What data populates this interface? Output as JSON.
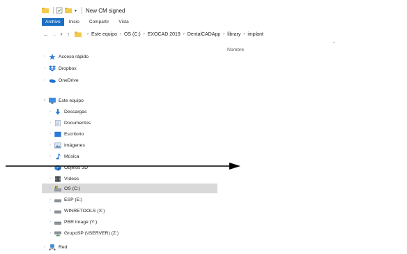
{
  "window": {
    "title": "New CM signed"
  },
  "ribbon": {
    "tabs": [
      "Archivo",
      "Inicio",
      "Compartir",
      "Vista"
    ]
  },
  "address": {
    "crumbs": [
      "Este equipo",
      "OS (C:)",
      "EXOCAD 2019",
      "DentalCADApp",
      "library",
      "implant"
    ]
  },
  "content": {
    "column_header": "Nombre"
  },
  "nav": {
    "items": [
      {
        "label": "Acceso rápido",
        "icon": "star-icon"
      },
      {
        "label": "Dropbox",
        "icon": "dropbox-icon"
      },
      {
        "label": "OneDrive",
        "icon": "cloud-icon"
      },
      {
        "label": "Este equipo",
        "icon": "computer-icon"
      },
      {
        "label": "Descargas",
        "icon": "download-icon"
      },
      {
        "label": "Documentos",
        "icon": "document-icon"
      },
      {
        "label": "Escritorio",
        "icon": "desktop-icon"
      },
      {
        "label": "Imágenes",
        "icon": "pictures-icon"
      },
      {
        "label": "Música",
        "icon": "music-icon"
      },
      {
        "label": "Objetos 3D",
        "icon": "objects-3d-icon"
      },
      {
        "label": "Vídeos",
        "icon": "videos-icon"
      },
      {
        "label": "OS (C:)",
        "icon": "drive-icon"
      },
      {
        "label": "ESP (E:)",
        "icon": "drive-icon"
      },
      {
        "label": "WINRETOOLS (X:)",
        "icon": "drive-icon"
      },
      {
        "label": "PBR Image (Y:)",
        "icon": "drive-icon"
      },
      {
        "label": "GrupoSP (\\\\SERVER) (Z:)",
        "icon": "network-drive-icon"
      },
      {
        "label": "Red",
        "icon": "network-icon"
      }
    ]
  },
  "colors": {
    "accent": "#1a6fc3",
    "selected_row": "#d9d9d9",
    "folder": "#f3c94b"
  }
}
